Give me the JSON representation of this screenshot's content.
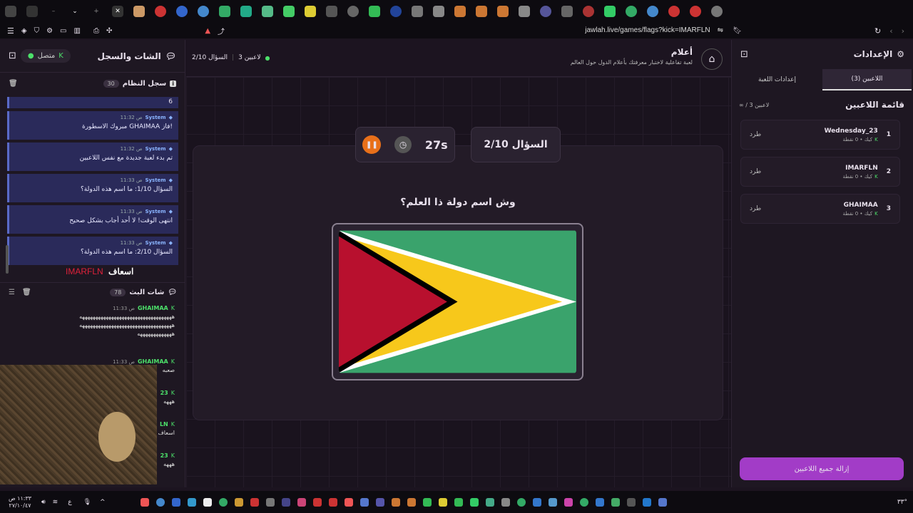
{
  "browser": {
    "url": "jawlah.live/games/flags?kick=IMARFLN"
  },
  "left_panel": {
    "title": "الشات والسجل",
    "status": "متصل",
    "system_log": {
      "title": "سجل النظام",
      "count": "30",
      "partial_top": "6",
      "messages": [
        {
          "sender": "System",
          "time": "11:32 ص",
          "text": "مبروك الاسطورة GHAIMAA فاز!"
        },
        {
          "sender": "System",
          "time": "11:32 ص",
          "text": "تم بدء لعبة جديدة مع نفس اللاعبين"
        },
        {
          "sender": "System",
          "time": "11:33 ص",
          "text": "السؤال 1/10: ما اسم هذه الدولة؟"
        },
        {
          "sender": "System",
          "time": "11:33 ص",
          "text": "انتهى الوقت! لا أحد أجاب بشكل صحيح"
        },
        {
          "sender": "System",
          "time": "11:33 ص",
          "text": "السؤال 2/10: ما اسم هذه الدولة؟"
        }
      ]
    },
    "overlay_name": "IMARFLN",
    "overlay_word": "اسعاف",
    "live_chat": {
      "title": "شات البث",
      "count": "78",
      "messages": [
        {
          "user": "GHAIMAA",
          "time": "11:33 ص",
          "lines": [
            "هههههههههههههههههههههههههههههههههههه",
            "هههههههههههههههههههههههههههههههههههه",
            "هههههههههههههه"
          ]
        },
        {
          "user": "GHAIMAA",
          "time": "11:33 ص",
          "lines": [
            "صعبه"
          ]
        },
        {
          "user": "23",
          "time": "",
          "lines": [
            "هههه"
          ]
        },
        {
          "user": "LN",
          "time": "",
          "lines": [
            "اسعاف"
          ]
        },
        {
          "user": "23",
          "time": "",
          "lines": [
            "هههه"
          ]
        }
      ]
    }
  },
  "header": {
    "title": "أعلام",
    "subtitle": "لعبة تفاعلية لاختبار معرفتك بأعلام الدول حول العالم",
    "players": "3 لاعبين",
    "question": "السؤال 2/10"
  },
  "game": {
    "question_counter": "السؤال 2/10",
    "timer": "27s",
    "prompt": "وش اسم دولة ذا العلم؟",
    "flag_colors": {
      "green": "#3aa36c",
      "yellow": "#f7c81b",
      "red": "#b8102e",
      "white": "#ffffff",
      "black": "#000000"
    }
  },
  "right_panel": {
    "title": "الإعدادات",
    "tabs": [
      "اللاعبين (3)",
      "إعدادات اللعبة"
    ],
    "list_title": "قائمة اللاعبين",
    "list_count": "∞ / 3 لاعبين",
    "players": [
      {
        "rank": "1",
        "name": "Wednesday_23",
        "sub": "كيك • 0 نقطة",
        "kick": "طرد"
      },
      {
        "rank": "2",
        "name": "IMARFLN",
        "sub": "كيك • 0 نقطة",
        "kick": "طرد"
      },
      {
        "rank": "3",
        "name": "GHAIMAA",
        "sub": "كيك • 0 نقطة",
        "kick": "طرد"
      }
    ],
    "remove_all": "إزالة جميع اللاعبين"
  },
  "taskbar": {
    "time": "١١:٣٣ ص",
    "date": "٢٧/١٠/٤٧",
    "lang": "ع",
    "temp": "٣٣°"
  }
}
